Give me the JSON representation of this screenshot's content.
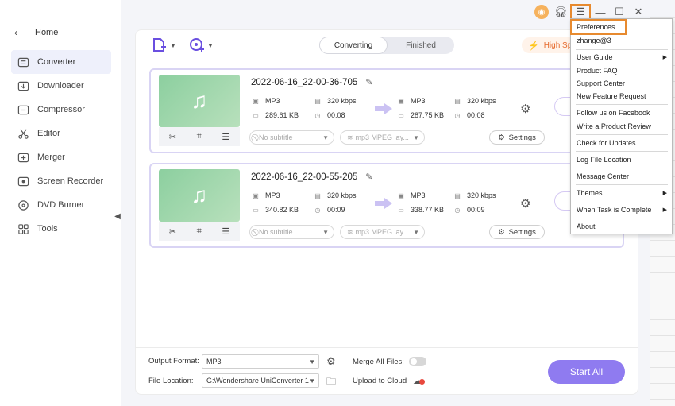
{
  "sidebar": {
    "home_label": "Home",
    "items": [
      {
        "label": "Converter",
        "icon": "converter-icon",
        "active": true
      },
      {
        "label": "Downloader",
        "icon": "downloader-icon"
      },
      {
        "label": "Compressor",
        "icon": "compressor-icon"
      },
      {
        "label": "Editor",
        "icon": "scissors-icon"
      },
      {
        "label": "Merger",
        "icon": "merger-icon"
      },
      {
        "label": "Screen Recorder",
        "icon": "screen-recorder-icon"
      },
      {
        "label": "DVD Burner",
        "icon": "dvd-icon"
      },
      {
        "label": "Tools",
        "icon": "tools-icon"
      }
    ]
  },
  "toolbar": {
    "tabs": [
      "Converting",
      "Finished"
    ],
    "active_tab": "Converting",
    "high_speed_label": "High Sp"
  },
  "files": [
    {
      "name": "2022-06-16_22-00-36-705",
      "src": {
        "format": "MP3",
        "bitrate": "320 kbps",
        "size": "289.61 KB",
        "duration": "00:08"
      },
      "dst": {
        "format": "MP3",
        "bitrate": "320 kbps",
        "size": "287.75 KB",
        "duration": "00:08"
      },
      "subtitle": "No subtitle",
      "audio": "mp3 MPEG lay...",
      "settings_label": "Settings"
    },
    {
      "name": "2022-06-16_22-00-55-205",
      "src": {
        "format": "MP3",
        "bitrate": "320 kbps",
        "size": "340.82 KB",
        "duration": "00:09"
      },
      "dst": {
        "format": "MP3",
        "bitrate": "320 kbps",
        "size": "338.77 KB",
        "duration": "00:09"
      },
      "subtitle": "No subtitle",
      "audio": "mp3 MPEG lay...",
      "settings_label": "Settings"
    }
  ],
  "bottom": {
    "output_format_label": "Output Format:",
    "output_format_value": "MP3",
    "file_location_label": "File Location:",
    "file_location_value": "G:\\Wondershare UniConverter 1",
    "merge_label": "Merge All Files:",
    "upload_label": "Upload to Cloud",
    "start_all_label": "Start All"
  },
  "menu": {
    "items": [
      {
        "label": "Preferences"
      },
      {
        "label": "zhange@3"
      },
      {
        "label": "User Guide",
        "submenu": true
      },
      {
        "label": "Product FAQ"
      },
      {
        "label": "Support Center"
      },
      {
        "label": "New Feature Request"
      },
      {
        "label": "Follow us on Facebook"
      },
      {
        "label": "Write a Product Review"
      },
      {
        "label": "Check for Updates"
      },
      {
        "label": "Log File Location"
      },
      {
        "label": "Message Center"
      },
      {
        "label": "Themes",
        "submenu": true
      },
      {
        "label": "When Task is Complete",
        "submenu": true
      },
      {
        "label": "About"
      }
    ]
  },
  "colors": {
    "accent": "#8f7bf0",
    "highlight": "#e78a2f",
    "card_border": "#d9d4f4"
  }
}
